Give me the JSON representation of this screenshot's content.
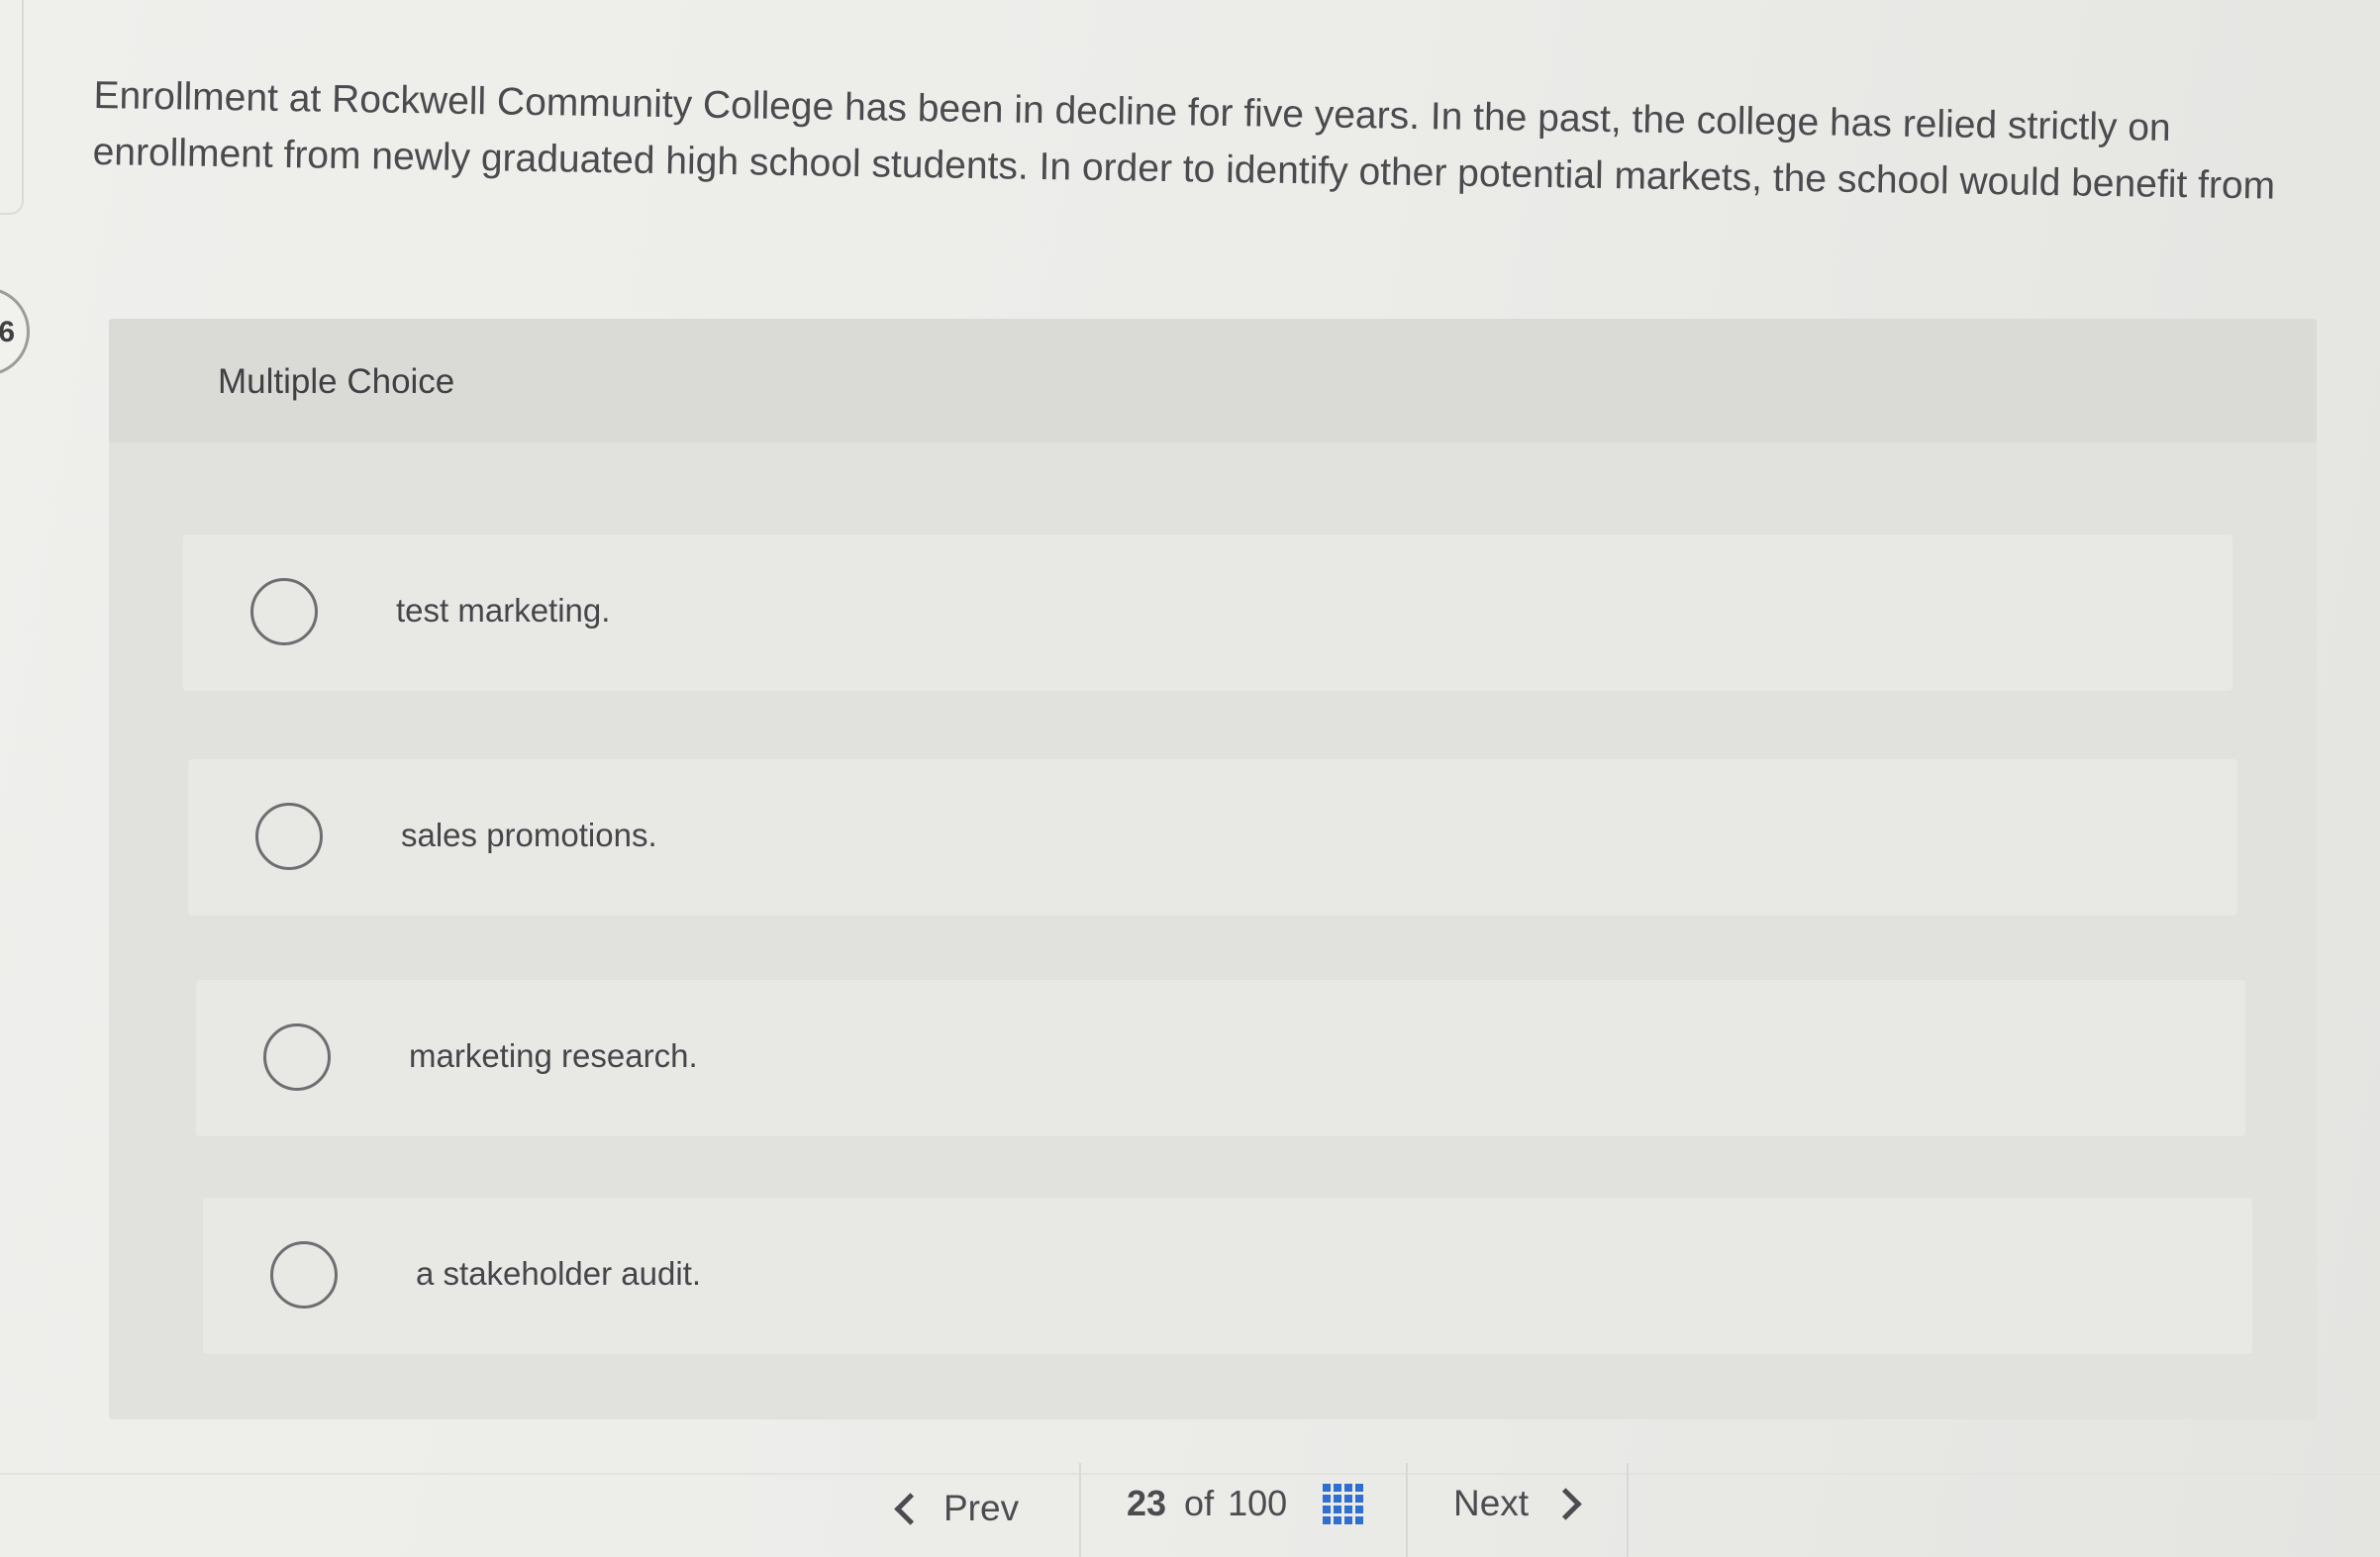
{
  "question": {
    "number": "6",
    "prompt": "Enrollment at Rockwell Community College has been in decline for five years. In the past, the college has relied strictly on enrollment from newly graduated high school students. In order to identify other potential markets, the school would benefit from",
    "type_label": "Multiple Choice",
    "choices": [
      {
        "label": "test marketing."
      },
      {
        "label": "sales promotions."
      },
      {
        "label": "marketing research."
      },
      {
        "label": "a stakeholder audit."
      }
    ]
  },
  "pagination": {
    "prev_label": "Prev",
    "current": "23",
    "of_label": "of",
    "total": "100",
    "next_label": "Next",
    "grid_icon": "grid-icon",
    "accent_color": "#2f6fcf"
  }
}
